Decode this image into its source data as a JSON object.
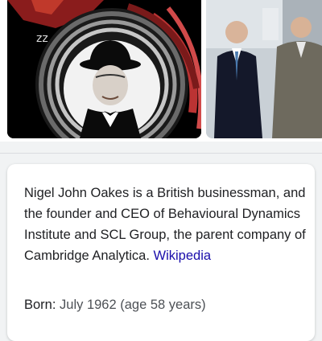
{
  "knowledge_panel": {
    "description": "Nigel John Oakes is a British businessman, and the founder and CEO of Behavioural Dynamics Institute and SCL Group, the parent company of Cambridge Analytica.",
    "source_link": "Wikipedia",
    "born_label": "Born:",
    "born_value": "July 1962 (age 58 years)"
  },
  "colors": {
    "link": "#1a0dab",
    "card_bg": "#ffffff",
    "page_bg": "#f1f3f4"
  }
}
